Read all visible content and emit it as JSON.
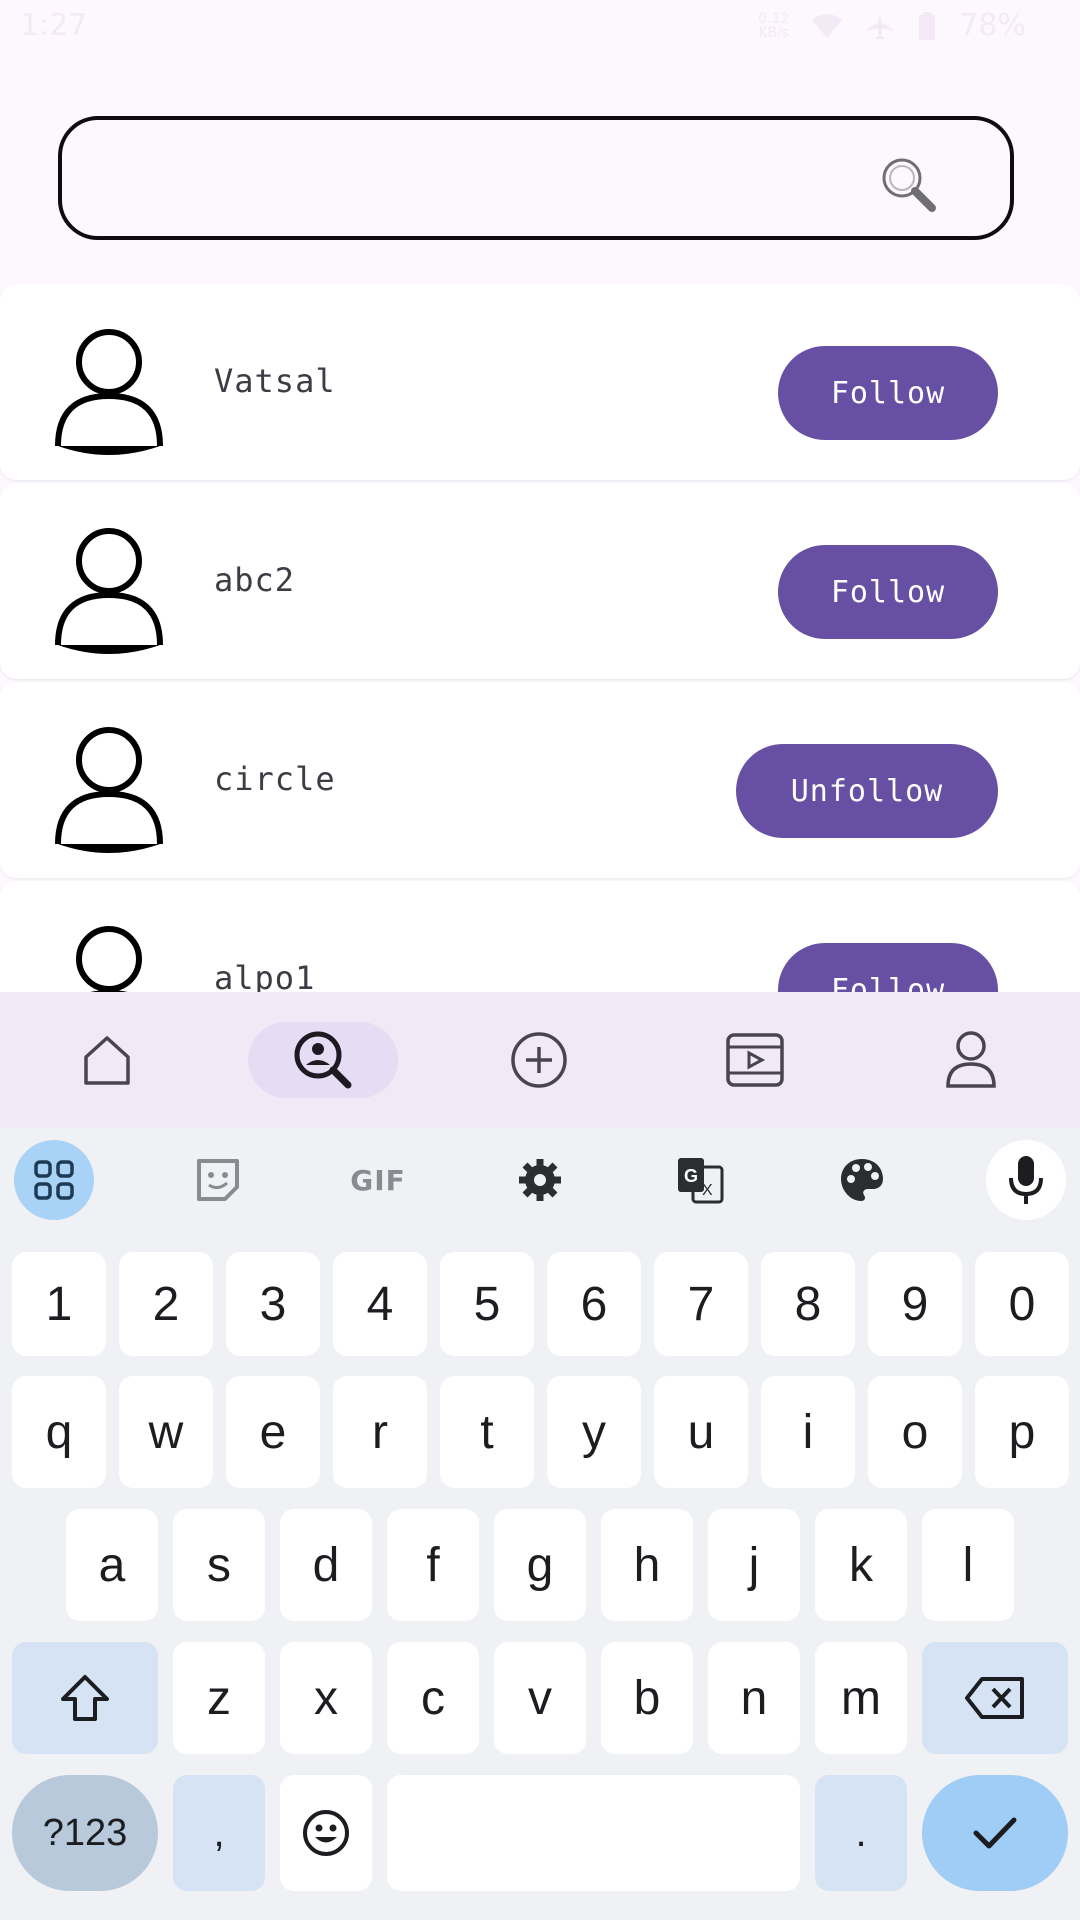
{
  "status_bar": {
    "time": "1:27",
    "net_speed": "0.12",
    "net_unit": "KB/s",
    "battery": "78%"
  },
  "search": {
    "value": "",
    "placeholder": ""
  },
  "users": [
    {
      "name": "Vatsal",
      "action": "Follow"
    },
    {
      "name": "abc2",
      "action": "Follow"
    },
    {
      "name": "circle",
      "action": "Unfollow"
    },
    {
      "name": "alpo1",
      "action": "Follow"
    }
  ],
  "bottom_nav": {
    "items": [
      "home-icon",
      "search-person-icon",
      "add-circle-icon",
      "video-icon",
      "profile-icon"
    ],
    "active": "search-person-icon"
  },
  "keyboard": {
    "toolbar": {
      "gif_label": "GIF"
    },
    "row_numbers": [
      "1",
      "2",
      "3",
      "4",
      "5",
      "6",
      "7",
      "8",
      "9",
      "0"
    ],
    "row1": [
      "q",
      "w",
      "e",
      "r",
      "t",
      "y",
      "u",
      "i",
      "o",
      "p"
    ],
    "row2": [
      "a",
      "s",
      "d",
      "f",
      "g",
      "h",
      "j",
      "k",
      "l"
    ],
    "row3": [
      "z",
      "x",
      "c",
      "v",
      "b",
      "n",
      "m"
    ],
    "symbols_label": "?123",
    "comma": ",",
    "period": "."
  },
  "colors": {
    "accent": "#6750a4",
    "background": "#fdf7fe",
    "nav_background": "#f2e9f7",
    "keyboard_background": "#eff1f5"
  }
}
